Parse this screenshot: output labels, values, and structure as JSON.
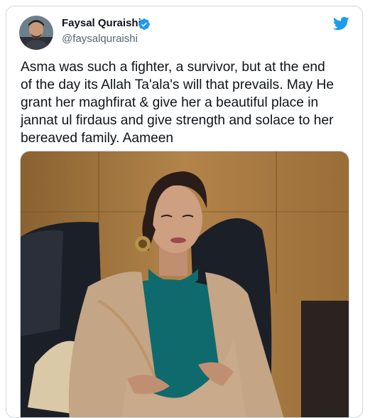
{
  "tweet": {
    "author": {
      "display_name": "Faysal Quraishi",
      "handle": "@faysalquraishi",
      "verified": true,
      "avatar_icon": "profile-photo"
    },
    "text": "Asma was such a fighter, a survivor, but at the end\nof the day its Allah Ta'ala's will that prevails. May He\ngrant her maghfirat & give her a beautiful place in\njannat ul firdaus and give strength and solace to her\nbereaved family. Aameen",
    "media": {
      "kind": "photo"
    },
    "brand_icon": "twitter-bird-icon"
  },
  "colors": {
    "text": "#0f1419",
    "secondary_text": "#536471",
    "twitter_blue": "#1d9bf0",
    "border": "#cfd9de"
  }
}
